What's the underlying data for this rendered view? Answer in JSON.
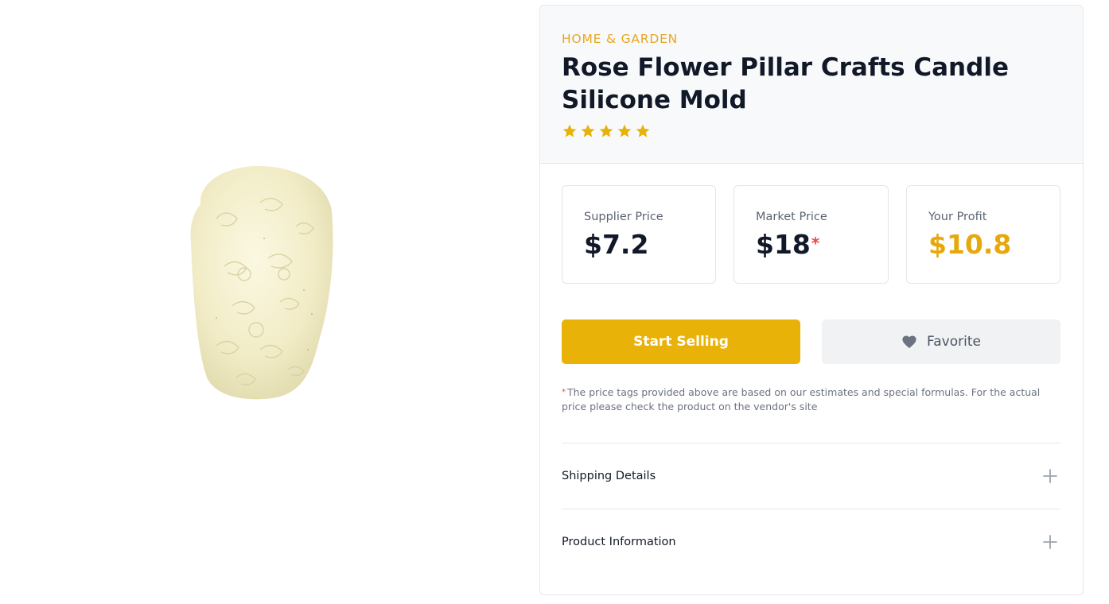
{
  "product": {
    "category": "HOME & GARDEN",
    "title": "Rose Flower Pillar Crafts Candle Silicone Mold",
    "rating": 5,
    "rating_max": 5
  },
  "prices": {
    "supplier": {
      "label": "Supplier Price",
      "value": "$7.2"
    },
    "market": {
      "label": "Market Price",
      "value": "$18",
      "marker": "*"
    },
    "profit": {
      "label": "Your Profit",
      "value": "$10.8"
    }
  },
  "actions": {
    "start_selling": "Start Selling",
    "favorite": "Favorite"
  },
  "note": {
    "marker": "*",
    "text": "The price tags provided above are based on our estimates and special formulas. For the actual price please check the product on the vendor's site"
  },
  "accordion": [
    {
      "label": "Shipping Details"
    },
    {
      "label": "Product Information"
    }
  ],
  "icons": {
    "star": "star-icon",
    "heart": "heart-icon",
    "plus": "plus-icon"
  },
  "colors": {
    "accent": "#e9b208",
    "category": "#e7a623",
    "profit": "#e7a80c",
    "required": "#ef4444"
  }
}
